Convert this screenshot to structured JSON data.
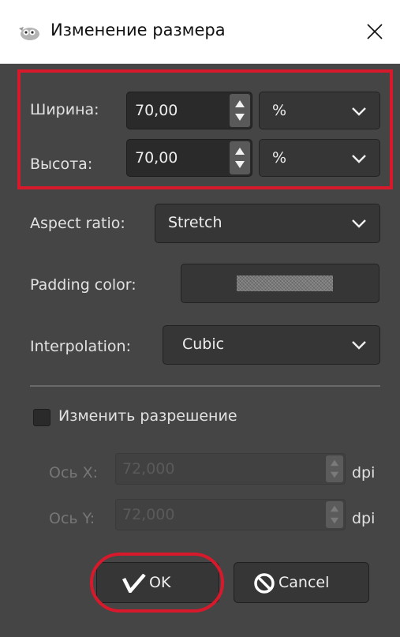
{
  "window": {
    "title": "Изменение размера",
    "app_icon": "gimp-icon",
    "close_icon": "close-icon"
  },
  "size": {
    "width_label": "Ширина:",
    "width_value": "70,00",
    "width_unit": "%",
    "height_label": "Высота:",
    "height_value": "70,00",
    "height_unit": "%"
  },
  "aspect": {
    "label": "Aspect ratio:",
    "value": "Stretch"
  },
  "padding": {
    "label": "Padding color:"
  },
  "interpolation": {
    "label": "Interpolation:",
    "value": "Cubic"
  },
  "resolution": {
    "checkbox_label": "Изменить разрешение",
    "checked": false,
    "x_label": "Ось X:",
    "x_value": "72,000",
    "x_unit": "dpi",
    "y_label": "Ось Y:",
    "y_value": "72,000",
    "y_unit": "dpi"
  },
  "buttons": {
    "ok": "OK",
    "cancel": "Cancel"
  },
  "colors": {
    "background": "#454545",
    "highlight": "#d8192c",
    "field": "#2a2a2a",
    "dropdown": "#363636"
  }
}
